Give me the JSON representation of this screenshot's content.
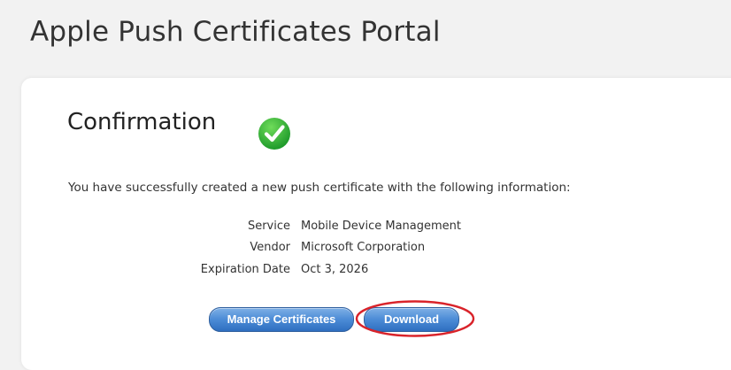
{
  "header": {
    "title": "Apple Push Certificates Portal"
  },
  "confirmation": {
    "heading": "Confirmation",
    "status_icon": "check-circle-icon",
    "status_color": "#2eb82e",
    "message": "You have successfully created a new push certificate with the following information:"
  },
  "details": [
    {
      "label": "Service",
      "value": "Mobile Device Management"
    },
    {
      "label": "Vendor",
      "value": "Microsoft Corporation"
    },
    {
      "label": "Expiration Date",
      "value": "Oct 3, 2026"
    }
  ],
  "actions": {
    "manage_label": "Manage Certificates",
    "download_label": "Download",
    "button_color": "#4b8bd6",
    "highlight_color": "#d9232a"
  }
}
